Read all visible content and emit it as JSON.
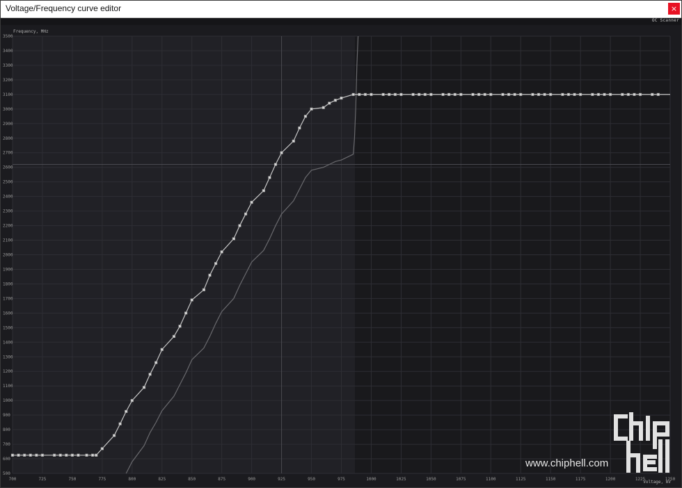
{
  "window": {
    "title": "Voltage/Frequency curve editor",
    "close_label": "×"
  },
  "toolbar": {
    "oc_scanner_label": "OC Scanner"
  },
  "chart_data": {
    "type": "line",
    "ylabel": "Frequency, MHz",
    "xlabel": "Voltage, mV",
    "xlim": [
      700,
      1250
    ],
    "ylim": [
      500,
      3500
    ],
    "x_ticks": [
      700,
      725,
      750,
      775,
      800,
      825,
      850,
      875,
      900,
      925,
      950,
      975,
      1000,
      1025,
      1050,
      1075,
      1100,
      1125,
      1150,
      1175,
      1200,
      1225,
      1250
    ],
    "y_ticks": [
      500,
      600,
      700,
      800,
      900,
      1000,
      1100,
      1200,
      1300,
      1400,
      1500,
      1600,
      1700,
      1800,
      1900,
      2000,
      2100,
      2200,
      2300,
      2400,
      2500,
      2600,
      2700,
      2800,
      2900,
      3000,
      3100,
      3200,
      3300,
      3400,
      3500
    ],
    "cursor": {
      "x": 925,
      "y": 2620
    },
    "active_limit_voltage": 987,
    "grid": true,
    "series": [
      {
        "role": "edited-curve",
        "color": "#c8c8c8",
        "points": [
          [
            700,
            625
          ],
          [
            705,
            625
          ],
          [
            710,
            625
          ],
          [
            715,
            625
          ],
          [
            720,
            625
          ],
          [
            725,
            625
          ],
          [
            735,
            625
          ],
          [
            740,
            625
          ],
          [
            745,
            625
          ],
          [
            750,
            625
          ],
          [
            755,
            625
          ],
          [
            762,
            625
          ],
          [
            767,
            625
          ],
          [
            770,
            625
          ],
          [
            775,
            670
          ],
          [
            785,
            760
          ],
          [
            790,
            840
          ],
          [
            795,
            925
          ],
          [
            800,
            1000
          ],
          [
            810,
            1090
          ],
          [
            815,
            1180
          ],
          [
            820,
            1260
          ],
          [
            825,
            1350
          ],
          [
            835,
            1440
          ],
          [
            840,
            1510
          ],
          [
            845,
            1600
          ],
          [
            850,
            1690
          ],
          [
            860,
            1760
          ],
          [
            865,
            1860
          ],
          [
            870,
            1940
          ],
          [
            875,
            2020
          ],
          [
            885,
            2110
          ],
          [
            890,
            2200
          ],
          [
            895,
            2280
          ],
          [
            900,
            2360
          ],
          [
            910,
            2440
          ],
          [
            915,
            2530
          ],
          [
            920,
            2620
          ],
          [
            925,
            2700
          ],
          [
            935,
            2780
          ],
          [
            940,
            2870
          ],
          [
            945,
            2950
          ],
          [
            950,
            3000
          ],
          [
            960,
            3010
          ],
          [
            965,
            3040
          ],
          [
            970,
            3060
          ],
          [
            975,
            3075
          ],
          [
            985,
            3100
          ],
          [
            990,
            3100
          ],
          [
            995,
            3100
          ],
          [
            1000,
            3100
          ],
          [
            1010,
            3100
          ],
          [
            1015,
            3100
          ],
          [
            1020,
            3100
          ],
          [
            1025,
            3100
          ],
          [
            1035,
            3100
          ],
          [
            1040,
            3100
          ],
          [
            1045,
            3100
          ],
          [
            1050,
            3100
          ],
          [
            1060,
            3100
          ],
          [
            1065,
            3100
          ],
          [
            1070,
            3100
          ],
          [
            1075,
            3100
          ],
          [
            1085,
            3100
          ],
          [
            1090,
            3100
          ],
          [
            1095,
            3100
          ],
          [
            1100,
            3100
          ],
          [
            1110,
            3100
          ],
          [
            1115,
            3100
          ],
          [
            1120,
            3100
          ],
          [
            1125,
            3100
          ],
          [
            1135,
            3100
          ],
          [
            1140,
            3100
          ],
          [
            1145,
            3100
          ],
          [
            1150,
            3100
          ],
          [
            1160,
            3100
          ],
          [
            1165,
            3100
          ],
          [
            1170,
            3100
          ],
          [
            1175,
            3100
          ],
          [
            1185,
            3100
          ],
          [
            1190,
            3100
          ],
          [
            1195,
            3100
          ],
          [
            1200,
            3100
          ],
          [
            1210,
            3100
          ],
          [
            1215,
            3100
          ],
          [
            1220,
            3100
          ],
          [
            1225,
            3100
          ],
          [
            1235,
            3100
          ],
          [
            1240,
            3100
          ]
        ],
        "line_end": [
          1250,
          3100
        ]
      },
      {
        "role": "default-curve",
        "color": "#6a6a6e",
        "points": [
          [
            795,
            500
          ],
          [
            800,
            580
          ],
          [
            810,
            690
          ],
          [
            815,
            780
          ],
          [
            820,
            850
          ],
          [
            825,
            930
          ],
          [
            835,
            1030
          ],
          [
            840,
            1110
          ],
          [
            845,
            1190
          ],
          [
            850,
            1280
          ],
          [
            860,
            1360
          ],
          [
            865,
            1440
          ],
          [
            870,
            1530
          ],
          [
            875,
            1610
          ],
          [
            885,
            1700
          ],
          [
            890,
            1790
          ],
          [
            895,
            1870
          ],
          [
            900,
            1950
          ],
          [
            910,
            2030
          ],
          [
            915,
            2110
          ],
          [
            920,
            2200
          ],
          [
            925,
            2280
          ],
          [
            935,
            2370
          ],
          [
            940,
            2450
          ],
          [
            945,
            2530
          ],
          [
            950,
            2580
          ],
          [
            960,
            2600
          ],
          [
            965,
            2620
          ],
          [
            970,
            2640
          ],
          [
            975,
            2650
          ],
          [
            985,
            2690
          ],
          [
            986,
            2800
          ],
          [
            987,
            3000
          ],
          [
            988,
            3300
          ],
          [
            989,
            3500
          ]
        ]
      }
    ]
  },
  "watermark": {
    "text": "www.chiphell.com"
  }
}
